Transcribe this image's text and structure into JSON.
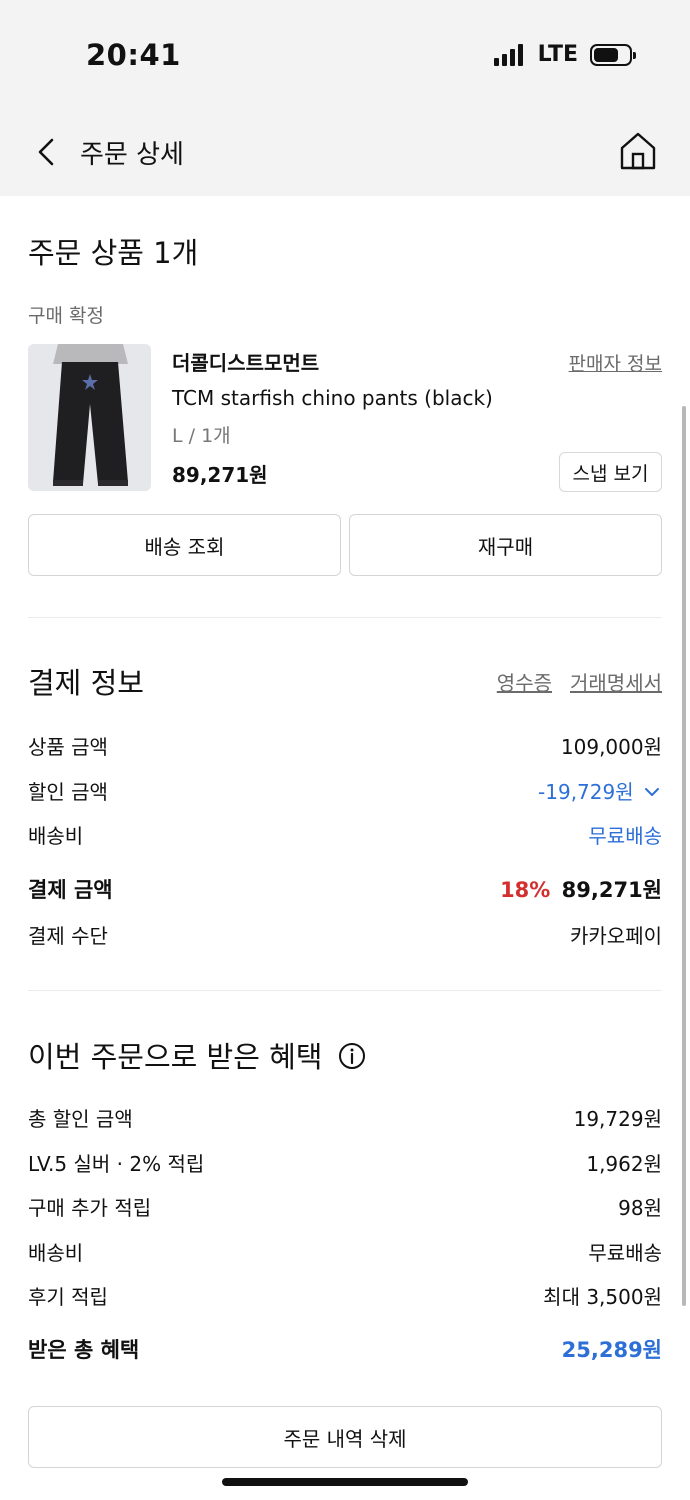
{
  "status_bar": {
    "time": "20:41",
    "network": "LTE"
  },
  "nav": {
    "title": "주문 상세"
  },
  "order": {
    "title": "주문 상품 1개",
    "status": "구매 확정",
    "product": {
      "brand": "더콜디스트모먼트",
      "seller_info_label": "판매자 정보",
      "name": "TCM starfish chino pants (black)",
      "option": "L / 1개",
      "price": "89,271원",
      "snap_label": "스냅 보기"
    },
    "track_label": "배송 조회",
    "reorder_label": "재구매"
  },
  "payment": {
    "title": "결제 정보",
    "receipt_label": "영수증",
    "statement_label": "거래명세서",
    "rows": [
      {
        "label": "상품 금액",
        "value": "109,000원"
      },
      {
        "label": "할인 금액",
        "value": "-19,729원"
      },
      {
        "label": "배송비",
        "value": "무료배송"
      },
      {
        "label": "결제 금액",
        "percent": "18%",
        "value": "89,271원"
      },
      {
        "label": "결제 수단",
        "value": "카카오페이"
      }
    ]
  },
  "benefits": {
    "title": "이번 주문으로 받은 혜택",
    "rows": [
      {
        "label": "총 할인 금액",
        "value": "19,729원"
      },
      {
        "label": "LV.5 실버 · 2% 적립",
        "value": "1,962원"
      },
      {
        "label": "구매 추가 적립",
        "value": "98원"
      },
      {
        "label": "배송비",
        "value": "무료배송"
      },
      {
        "label": "후기 적립",
        "value": "최대 3,500원"
      }
    ],
    "total_label": "받은 총 혜택",
    "total_value": "25,289원"
  },
  "delete_label": "주문 내역 삭제",
  "colors": {
    "accent_blue": "#2d6fd7",
    "discount_red": "#d32f2f",
    "header_bg": "#f3f3f3"
  },
  "icons": [
    "back-arrow-icon",
    "home-icon",
    "chevron-down-icon",
    "info-icon",
    "star-icon"
  ]
}
